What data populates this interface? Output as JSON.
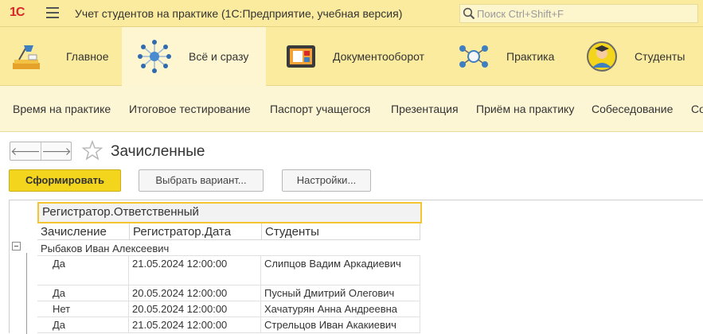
{
  "app": {
    "logo": "1С",
    "title": "Учет студентов на практике  (1С:Предприятие, учебная версия)",
    "search_placeholder": "Поиск Ctrl+Shift+F"
  },
  "sections": [
    {
      "label": "Главное",
      "icon": "home-desk-icon"
    },
    {
      "label": "Всё и сразу",
      "icon": "all-network-icon",
      "active": true
    },
    {
      "label": "Документооборот",
      "icon": "documents-icon"
    },
    {
      "label": "Практика",
      "icon": "practice-icon"
    },
    {
      "label": "Студенты",
      "icon": "students-icon"
    }
  ],
  "commands": [
    "Время на практике",
    "Итоговое тестирование",
    "Паспорт учащегося",
    "Презентация",
    "Приём на практику",
    "Собеседование",
    "Со"
  ],
  "form": {
    "back": "🡐",
    "forward": "🡒",
    "title": "Зачисленные",
    "buttons": {
      "generate": "Сформировать",
      "choose_variant": "Выбрать вариант...",
      "settings": "Настройки..."
    }
  },
  "report": {
    "group_header": "Регистратор.Ответственный",
    "columns": [
      "Зачисление",
      "Регистратор.Дата",
      "Студенты"
    ],
    "group": "Рыбаков Иван Алексеевич",
    "rows": [
      {
        "enrolled": "Да",
        "date": "21.05.2024 12:00:00",
        "student": "Слипцов Вадим Аркадиевич"
      },
      {
        "enrolled": "Да",
        "date": "20.05.2024 12:00:00",
        "student": "Пусный Дмитрий Олегович"
      },
      {
        "enrolled": "Нет",
        "date": "20.05.2024 12:00:00",
        "student": "Хачатурян Анна Андреевна"
      },
      {
        "enrolled": "Да",
        "date": "21.05.2024 12:00:00",
        "student": "Стрельцов Иван Акакиевич"
      }
    ]
  },
  "colors": {
    "panel": "#fbeb9e",
    "commands": "#fdf6d4",
    "primary_button": "#f3d51d",
    "logo": "#d8282a",
    "group_header_border": "#f4c531"
  }
}
